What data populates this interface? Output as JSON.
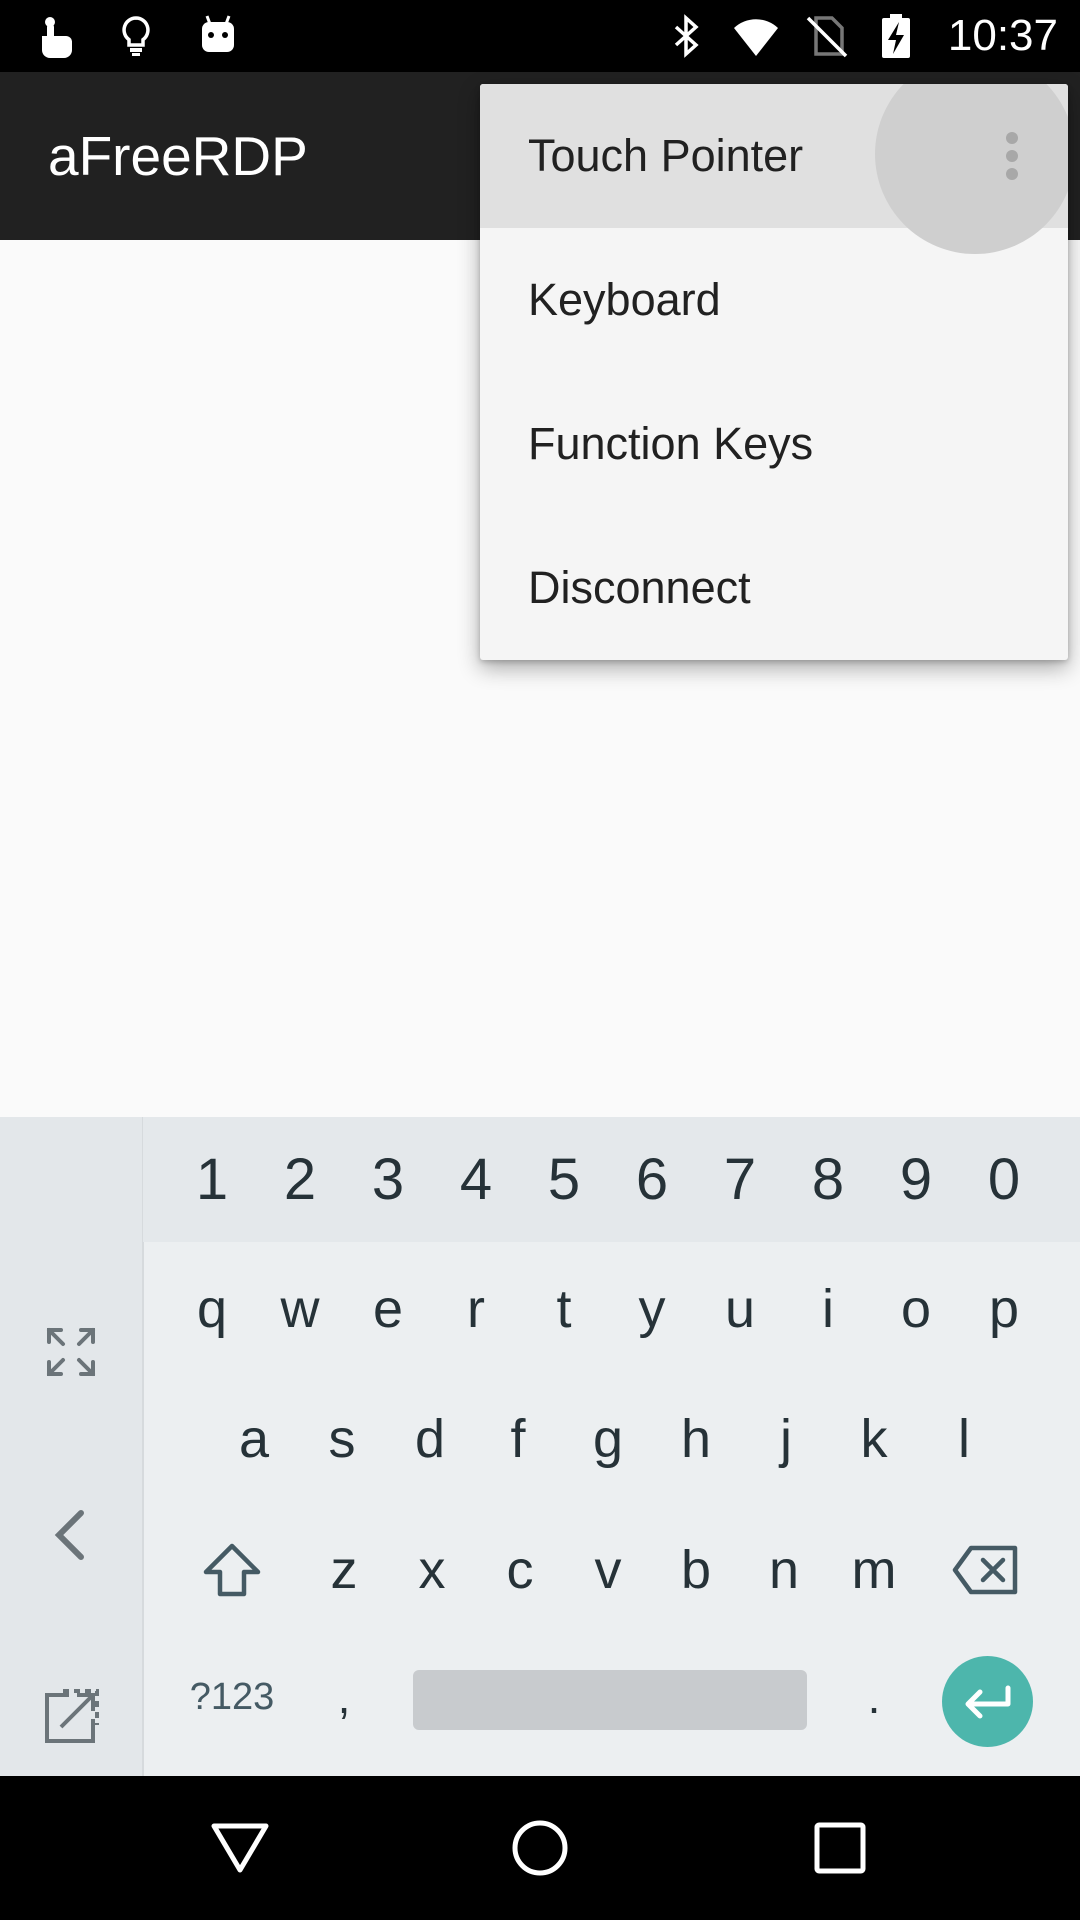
{
  "status_bar": {
    "time": "10:37",
    "left_icons": [
      "touch-icon",
      "lightbulb-icon",
      "android-icon"
    ],
    "right_icons": [
      "bluetooth-icon",
      "wifi-icon",
      "no-sim-icon",
      "battery-charging-icon"
    ]
  },
  "app_bar": {
    "title": "aFreeRDP",
    "overflow_icon": "more-vert-icon"
  },
  "menu": {
    "items": [
      {
        "label": "Touch Pointer",
        "pressed": true
      },
      {
        "label": "Keyboard"
      },
      {
        "label": "Function Keys"
      },
      {
        "label": "Disconnect"
      }
    ]
  },
  "keyboard": {
    "left_panel_icons": [
      "fullscreen-icon",
      "chevron-left-icon",
      "undock-icon"
    ],
    "number_row": [
      "1",
      "2",
      "3",
      "4",
      "5",
      "6",
      "7",
      "8",
      "9",
      "0"
    ],
    "row1": [
      "q",
      "w",
      "e",
      "r",
      "t",
      "y",
      "u",
      "i",
      "o",
      "p"
    ],
    "row2": [
      "a",
      "s",
      "d",
      "f",
      "g",
      "h",
      "j",
      "k",
      "l"
    ],
    "row3": [
      "z",
      "x",
      "c",
      "v",
      "b",
      "n",
      "m"
    ],
    "symbols_key": "?123",
    "comma_key": ",",
    "period_key": ".",
    "shift_icon": "shift-icon",
    "backspace_icon": "backspace-icon",
    "enter_icon": "enter-icon",
    "enter_color": "#4db6ac"
  },
  "nav_bar": {
    "icons": [
      "back-icon",
      "home-icon",
      "recents-icon"
    ]
  }
}
